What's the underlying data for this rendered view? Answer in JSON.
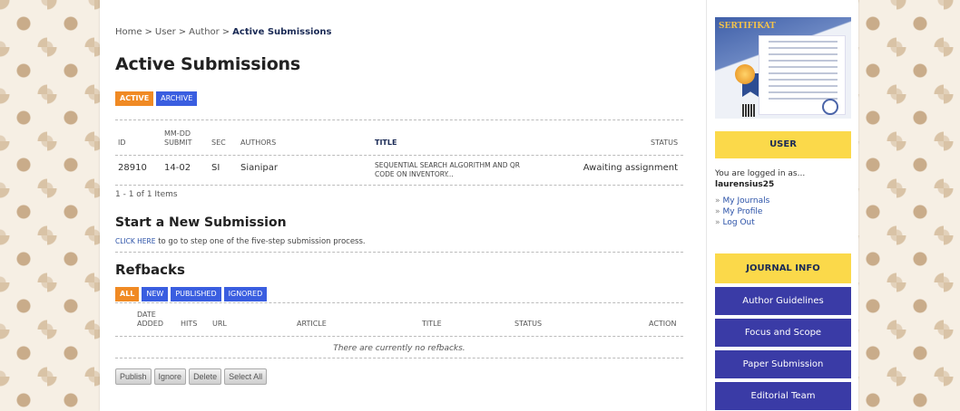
{
  "breadcrumb": {
    "home": "Home",
    "user": "User",
    "author": "Author",
    "current": "Active Submissions",
    "separator": ">"
  },
  "page_title": "Active Submissions",
  "submission_tabs": [
    {
      "label": "ACTIVE",
      "active": true
    },
    {
      "label": "ARCHIVE",
      "active": false
    }
  ],
  "submissions": {
    "columns": {
      "id": "ID",
      "date_top": "MM-DD",
      "date_bottom": "SUBMIT",
      "sec": "SEC",
      "authors": "AUTHORS",
      "title": "TITLE",
      "status": "STATUS"
    },
    "rows": [
      {
        "id": "28910",
        "date": "14-02",
        "sec": "SI",
        "authors": "Sianipar",
        "title_line1": "SEQUENTIAL SEARCH ALGORITHM AND QR",
        "title_line2": "CODE ON INVENTORY...",
        "status": "Awaiting assignment"
      }
    ],
    "items_label": "1 - 1 of 1 Items"
  },
  "new_submission": {
    "heading": "Start a New Submission",
    "link_label": "CLICK HERE",
    "text": " to go to step one of the five-step submission process."
  },
  "refbacks": {
    "heading": "Refbacks",
    "tabs": [
      {
        "label": "ALL",
        "active": true
      },
      {
        "label": "NEW",
        "active": false
      },
      {
        "label": "PUBLISHED",
        "active": false
      },
      {
        "label": "IGNORED",
        "active": false
      }
    ],
    "columns": {
      "date_top": "DATE",
      "date_bottom": "ADDED",
      "hits": "HITS",
      "url": "URL",
      "article": "ARTICLE",
      "title": "TITLE",
      "status": "STATUS",
      "action": "ACTION"
    },
    "empty_text": "There are currently no refbacks.",
    "buttons": {
      "publish": "Publish",
      "ignore": "Ignore",
      "delete": "Delete",
      "select_all": "Select All"
    }
  },
  "sidebar": {
    "certificate": {
      "title": "SERTIFIKAT"
    },
    "user_block": {
      "heading": "USER",
      "logged_in_text": "You are logged in as...",
      "username": "laurensius25",
      "links": [
        "My Journals",
        "My Profile",
        "Log Out"
      ]
    },
    "journal_info": {
      "heading": "JOURNAL INFO",
      "links": [
        "Author Guidelines",
        "Focus and Scope",
        "Paper Submission",
        "Editorial Team"
      ]
    }
  },
  "colors": {
    "tab_active": "#f08a24",
    "tab_inactive": "#3a5ee0",
    "sidebar_header": "#fbd94a",
    "sidebar_link_bg": "#3a3ba6",
    "link": "#2b52a8"
  }
}
